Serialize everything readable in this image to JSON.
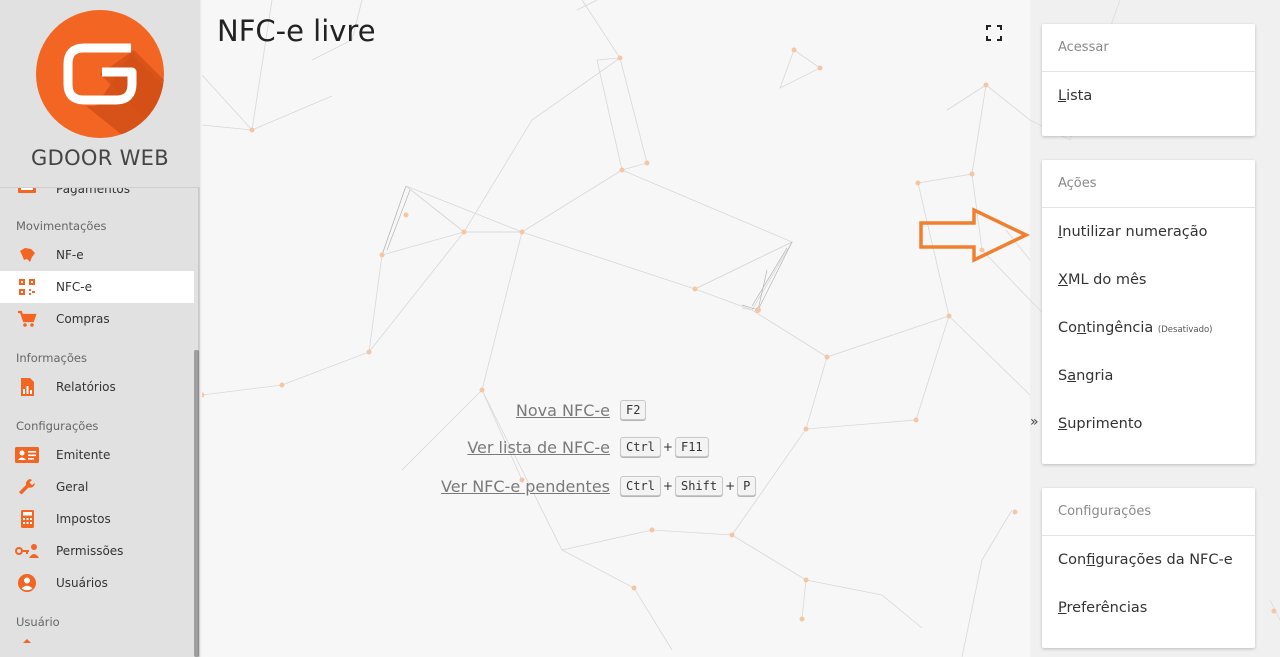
{
  "brand": {
    "name": "GDOOR WEB",
    "logo_color": "#f26522"
  },
  "sidebar": {
    "partial_item": {
      "label": "Pagamentos",
      "icon": "payment-icon"
    },
    "sections": [
      {
        "title": "Movimentações",
        "items": [
          {
            "label": "NF-e",
            "icon": "brazil-map-icon"
          },
          {
            "label": "NFC-e",
            "icon": "qr-code-icon",
            "active": true
          },
          {
            "label": "Compras",
            "icon": "cart-icon"
          }
        ]
      },
      {
        "title": "Informações",
        "items": [
          {
            "label": "Relatórios",
            "icon": "report-icon"
          }
        ]
      },
      {
        "title": "Configurações",
        "items": [
          {
            "label": "Emitente",
            "icon": "id-card-icon"
          },
          {
            "label": "Geral",
            "icon": "wrench-icon"
          },
          {
            "label": "Impostos",
            "icon": "calculator-icon"
          },
          {
            "label": "Permissões",
            "icon": "key-user-icon"
          },
          {
            "label": "Usuários",
            "icon": "user-circle-icon"
          }
        ]
      },
      {
        "title": "Usuário",
        "items": []
      }
    ]
  },
  "main": {
    "title": "NFC-e livre",
    "fullscreen_icon": "fullscreen-icon",
    "shortcuts": [
      {
        "label": "Nova NFC-e",
        "keys": [
          "F2"
        ]
      },
      {
        "label": "Ver lista de NFC-e",
        "keys": [
          "Ctrl",
          "F11"
        ]
      },
      {
        "label": "Ver NFC-e pendentes",
        "keys": [
          "Ctrl",
          "Shift",
          "P"
        ]
      }
    ],
    "key_separator": "+"
  },
  "panel": {
    "collapse_label": "»",
    "cards": [
      {
        "header": "Acessar",
        "items": [
          {
            "label": "Lista",
            "u": "L",
            "rest": "ista"
          }
        ]
      },
      {
        "header": "Ações",
        "items": [
          {
            "label": "Inutilizar numeração",
            "u": "I",
            "rest": "nutilizar numeração"
          },
          {
            "label": "XML do mês",
            "u": "X",
            "rest": "ML do mês"
          },
          {
            "label": "Contingência",
            "pre": "Co",
            "u": "n",
            "rest": "tingência",
            "note": "(Desativado)"
          },
          {
            "label": "Sangria",
            "pre": "S",
            "u": "a",
            "rest": "ngria"
          },
          {
            "label": "Suprimento",
            "u": "S",
            "rest": "uprimento"
          }
        ]
      },
      {
        "header": "Configurações",
        "items": [
          {
            "label": "Configurações da NFC-e",
            "pre": "Con",
            "u": "f",
            "rest": "igurações da NFC-e"
          },
          {
            "label": "Preferências",
            "u": "P",
            "rest": "referências"
          }
        ]
      }
    ]
  },
  "colors": {
    "accent": "#f26522",
    "annotation_arrow": "#f08030"
  }
}
